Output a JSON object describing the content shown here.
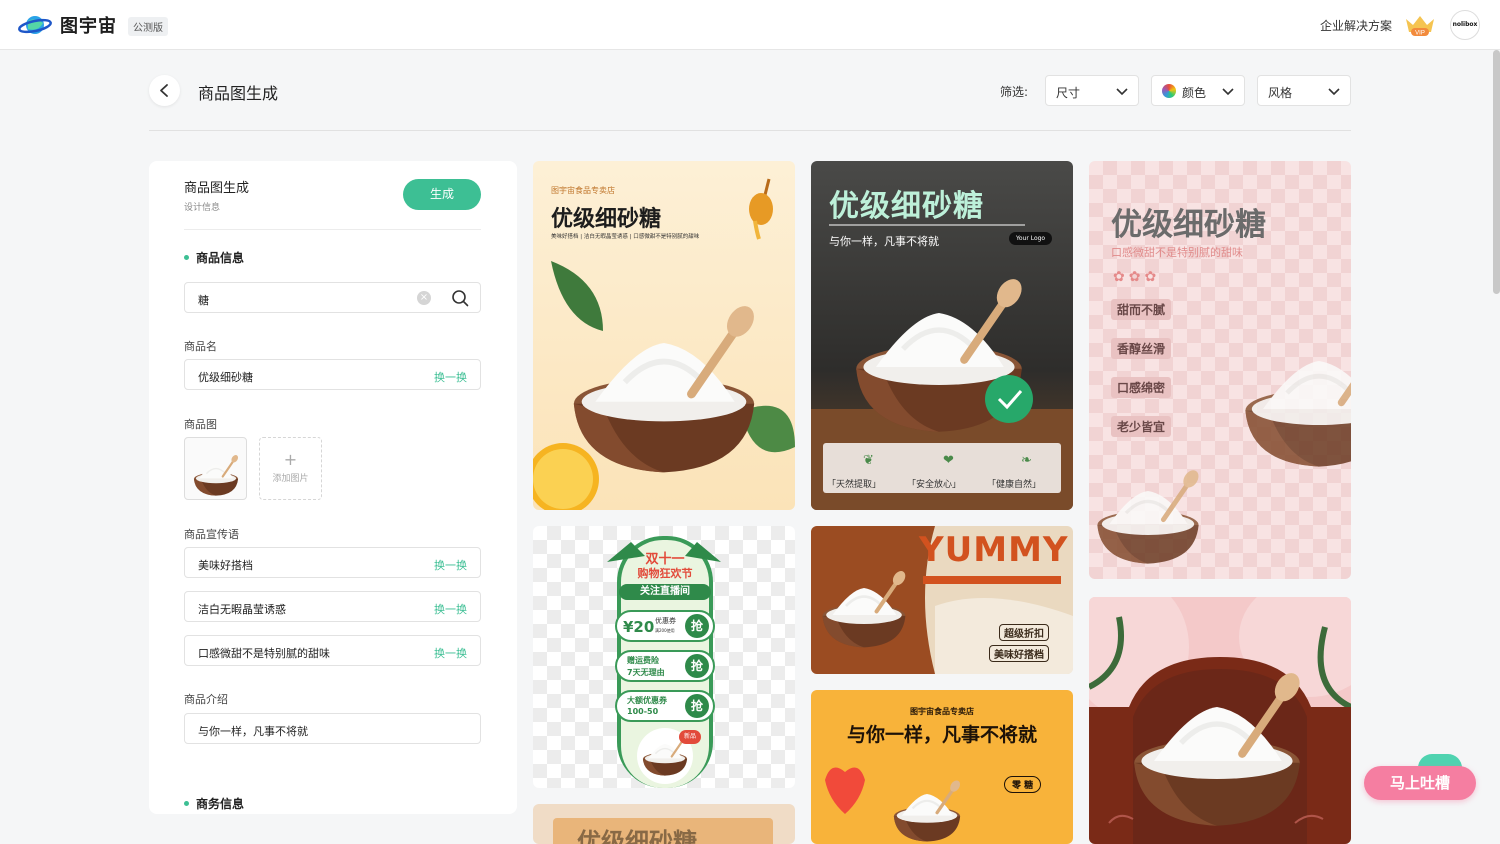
{
  "app": {
    "brand": "图宇宙",
    "beta_badge": "公测版",
    "enterprise_link": "企业解决方案",
    "vip_label": "VIP",
    "avatar_text": "nolibox"
  },
  "header": {
    "title": "商品图生成",
    "filter_label": "筛选:",
    "filters": [
      {
        "label": "尺寸"
      },
      {
        "label": "颜色"
      },
      {
        "label": "风格"
      }
    ]
  },
  "panel": {
    "title": "商品图生成",
    "subtitle": "设计信息",
    "generate_label": "生成",
    "section_product": "商品信息",
    "search_value": "糖",
    "name_label": "商品名",
    "name_value": "优级细砂糖",
    "swap_label": "换一换",
    "image_label": "商品图",
    "add_image_label": "添加图片",
    "slogan_label": "商品宣传语",
    "slogans": [
      "美味好搭档",
      "洁白无暇晶莹诱惑",
      "口感微甜不是特别腻的甜味"
    ],
    "intro_label": "商品介绍",
    "intro_value": "与你一样，凡事不将就",
    "section_business": "商务信息"
  },
  "cards": {
    "c1": {
      "store": "图宇宙食品专卖店",
      "title": "优级细砂糖",
      "sub": "美味好搭档 | 洁白无暇晶莹诱惑 | 口感微甜不是特别腻的甜味"
    },
    "c2": {
      "title": "优级细砂糖",
      "sub": "与你一样，凡事不将就",
      "logo": "Your Logo",
      "features": [
        "「天然提取」",
        "「安全放心」",
        "「健康自然」"
      ]
    },
    "c3": {
      "title": "优级细砂糖",
      "sub": "口感微甜不是特别腻的甜味",
      "tags": [
        "甜而不腻",
        "香醇丝滑",
        "口感绵密",
        "老少皆宜"
      ]
    },
    "c4": {
      "banner1": "双十一",
      "banner2": "购物狂欢节",
      "live": "关注直播间",
      "coupon_value": "¥20",
      "coupon_name": "优惠券",
      "coupon_cond": "满200使用",
      "grab": "抢",
      "ship1": "赠运费险",
      "ship2": "7天无理由",
      "big1": "大额优惠券",
      "big2": "100-50",
      "new_badge": "新品"
    },
    "c5": {
      "title": "YUMMY",
      "tag1": "超级折扣",
      "tag2": "美味好搭档"
    },
    "c6": {
      "store": "图宇宙食品专卖店",
      "title": "与你一样，凡事不将就",
      "badge": "零 糖"
    },
    "c8": {
      "title": "优级细砂糖"
    }
  },
  "feedback_button": "马上吐槽",
  "colors": {
    "accent": "#3dbf94",
    "feedback": "#f57ea1",
    "brown": "#6b2718"
  }
}
